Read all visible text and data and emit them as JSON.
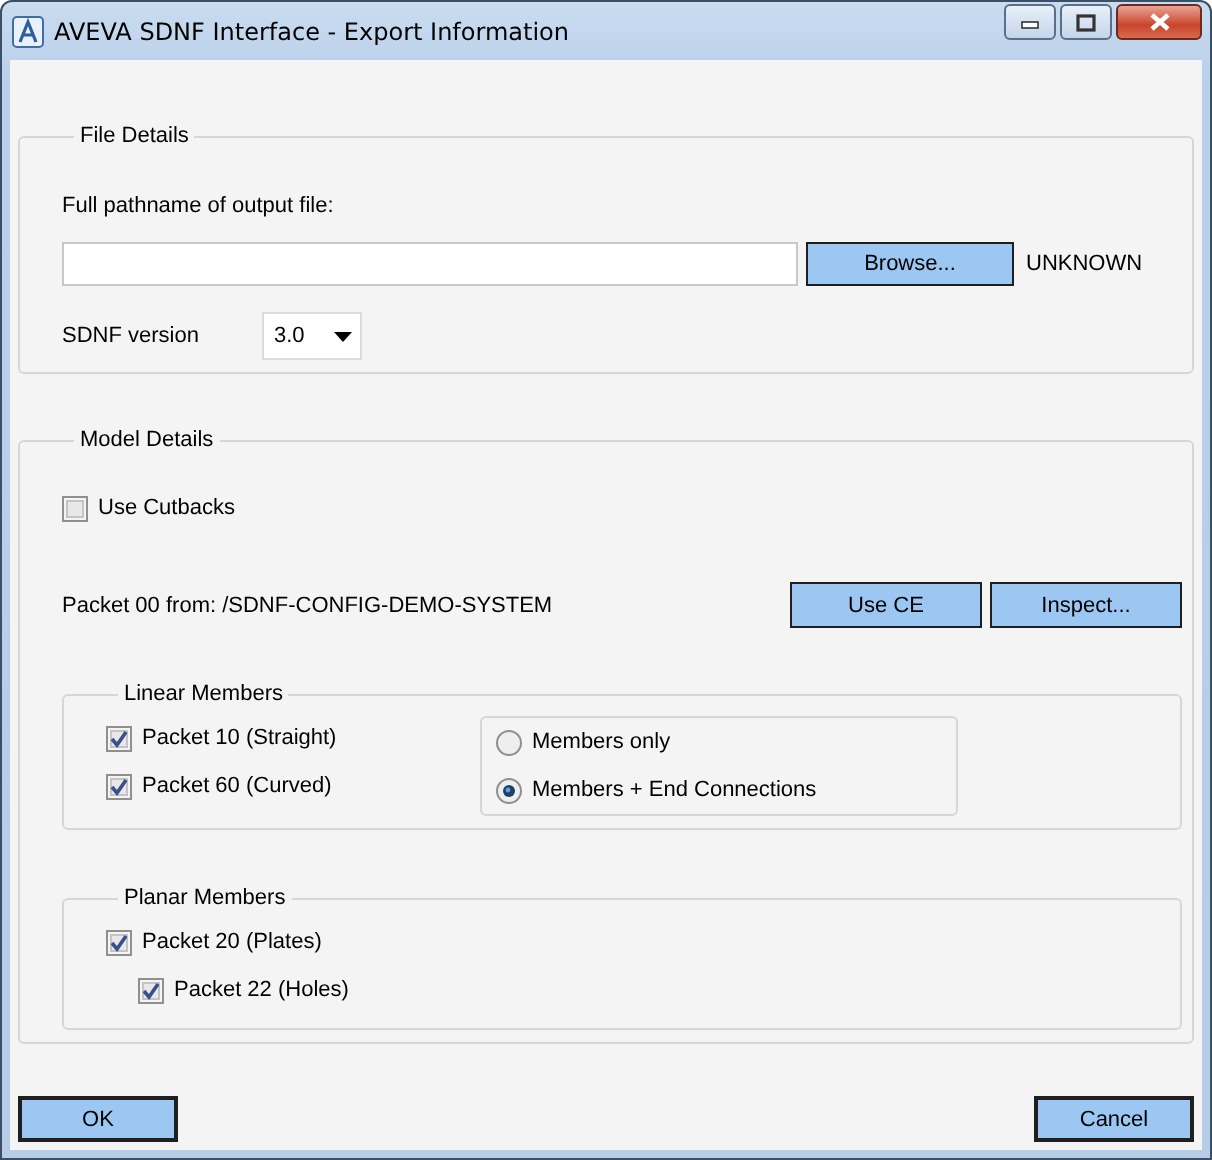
{
  "window": {
    "title": "AVEVA SDNF Interface - Export Information"
  },
  "file_details": {
    "legend": "File Details",
    "path_label": "Full pathname of output file:",
    "browse_button": "Browse...",
    "status": "UNKNOWN",
    "version_label": "SDNF version",
    "version_dropdown": {
      "value": "3.0"
    }
  },
  "model_details": {
    "legend": "Model Details",
    "use_cutbacks": {
      "label": "Use Cutbacks",
      "checked": false
    },
    "packet_source": "Packet 00 from: /SDNF-CONFIG-DEMO-SYSTEM",
    "buttons": [
      "Use CE",
      "Inspect..."
    ],
    "linear_members": {
      "legend": "Linear Members",
      "packets": [
        {
          "label": "Packet 10 (Straight)",
          "checked": true
        },
        {
          "label": "Packet 60 (Curved)",
          "checked": true
        }
      ],
      "options": [
        {
          "label": "Members only",
          "selected": false
        },
        {
          "label": "Members + End Connections",
          "selected": true
        }
      ]
    },
    "planar_members": {
      "legend": "Planar Members",
      "packets": [
        {
          "label": "Packet 20 (Plates)",
          "checked": true,
          "children": [
            {
              "label": "Packet 22 (Holes)",
              "checked": true
            }
          ]
        }
      ]
    }
  },
  "buttons": [
    "OK",
    "Cancel"
  ]
}
